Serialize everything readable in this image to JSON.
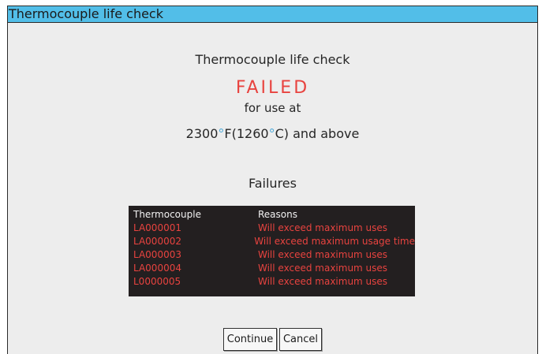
{
  "window": {
    "title": "Thermocouple life check"
  },
  "main": {
    "heading": "Thermocouple life check",
    "status": "FAILED",
    "for_use_at": "for use at",
    "temp_f_value": "2300",
    "degree_symbol": "°",
    "temp_f_unit": "F(1260",
    "temp_c_unit": "C) and above",
    "failures_heading": "Failures"
  },
  "failures_table": {
    "columns": [
      "Thermocouple",
      "Reasons"
    ],
    "rows": [
      {
        "thermocouple": "LA000001",
        "reason": "Will exceed maximum uses"
      },
      {
        "thermocouple": "LA000002",
        "reason": "Will exceed maximum usage time"
      },
      {
        "thermocouple": "LA000003",
        "reason": "Will exceed maximum uses"
      },
      {
        "thermocouple": "LA000004",
        "reason": "Will exceed maximum uses"
      },
      {
        "thermocouple": "L0000005",
        "reason": "Will exceed maximum uses"
      }
    ]
  },
  "buttons": {
    "continue_label": "Continue",
    "cancel_label": "Cancel"
  },
  "colors": {
    "titlebar": "#52bee8",
    "failed_red": "#e8433f",
    "degree_blue": "#4aa8d8",
    "table_background": "#231f20"
  }
}
